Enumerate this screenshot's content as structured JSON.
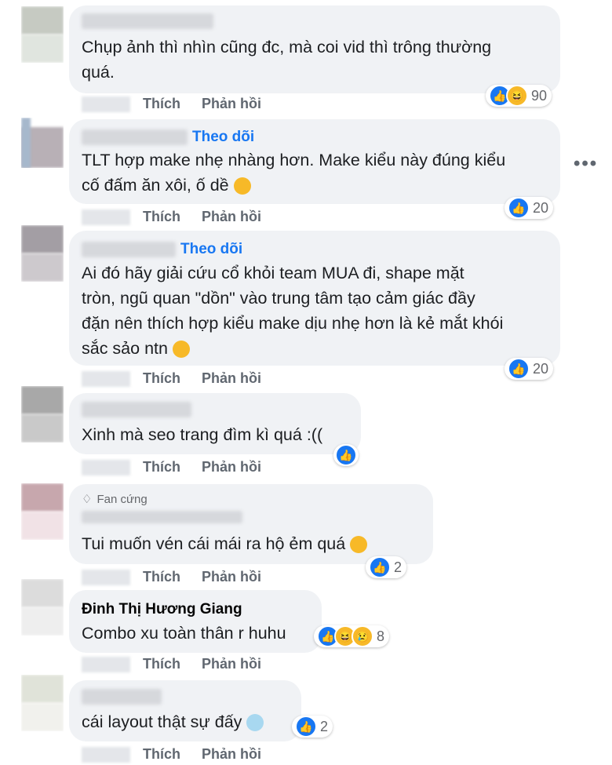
{
  "actions": {
    "like": "Thích",
    "reply": "Phản hồi"
  },
  "follow_label": "Theo dõi",
  "comments": [
    {
      "text_lines": [
        "Chụp ảnh thì nhìn cũng đc, mà coi vid thì trông thường",
        "quá."
      ],
      "reactions": [
        "like",
        "haha"
      ],
      "count": "90"
    },
    {
      "text_lines": [
        "TLT hợp make nhẹ nhàng hơn. Make kiểu này đúng kiểu",
        "cố đấm ăn xôi, ố dề"
      ],
      "reactions": [
        "like"
      ],
      "count": "20"
    },
    {
      "text_lines": [
        "Ai đó hãy giải cứu cổ khỏi team MUA đi, shape mặt",
        "tròn, ngũ quan \"dồn\" vào trung tâm tạo cảm giác đầy",
        "đặn nên thích hợp kiểu make dịu nhẹ hơn là kẻ mắt khói",
        "sắc sảo ntn"
      ],
      "reactions": [
        "like"
      ],
      "count": "20"
    },
    {
      "text_lines": [
        "Xinh mà seo trang đìm kì quá :(("
      ],
      "reactions": [
        "like"
      ],
      "count": ""
    },
    {
      "badge": "Fan cứng",
      "text_lines": [
        "Tui muốn vén cái mái ra hộ ẻm quá"
      ],
      "reactions": [
        "like"
      ],
      "count": "2"
    },
    {
      "author": "Đinh Thị Hương Giang",
      "text_lines": [
        "Combo xu toàn thân r huhu"
      ],
      "reactions": [
        "like",
        "haha",
        "sad"
      ],
      "count": "8"
    },
    {
      "text_lines": [
        "cái layout thật sự đấy"
      ],
      "reactions": [
        "like"
      ],
      "count": "2"
    }
  ],
  "colors": {
    "accent": "#1877f2",
    "bubble": "#f0f2f5",
    "muted": "#606770"
  },
  "icons": {
    "more": "more-dots-icon",
    "like": "like-reaction-icon",
    "haha": "haha-reaction-icon",
    "sad": "sad-reaction-icon"
  }
}
